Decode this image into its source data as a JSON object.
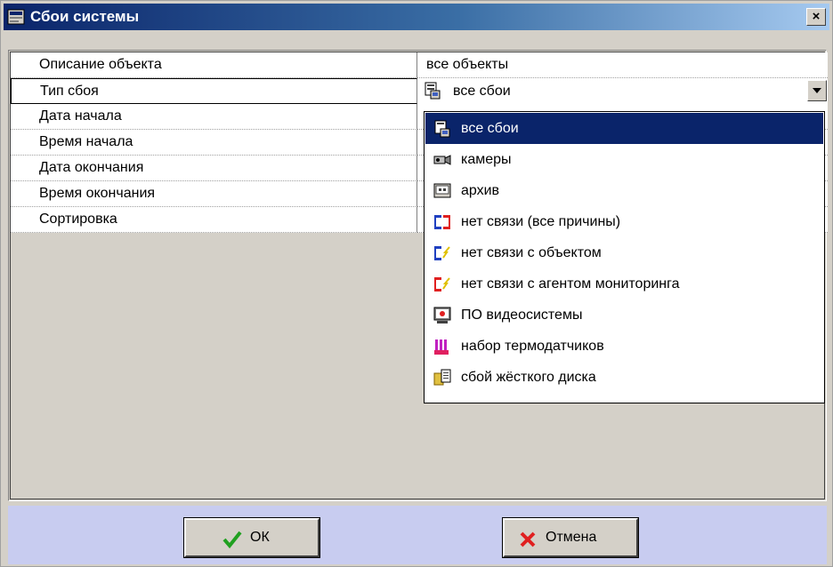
{
  "window": {
    "title": "Сбои системы",
    "close_label": "×"
  },
  "properties": [
    {
      "label": "Описание объекта",
      "value": "все объекты"
    },
    {
      "label": "Тип сбоя",
      "value": "все сбои"
    },
    {
      "label": "Дата начала",
      "value": ""
    },
    {
      "label": "Время начала",
      "value": ""
    },
    {
      "label": "Дата окончания",
      "value": ""
    },
    {
      "label": "Время окончания",
      "value": ""
    },
    {
      "label": "Сортировка",
      "value": ""
    }
  ],
  "dropdown": {
    "selected": "все сбои",
    "items": [
      {
        "label": "все сбои",
        "icon": "all-failures-icon"
      },
      {
        "label": "камеры",
        "icon": "camera-icon"
      },
      {
        "label": "архив",
        "icon": "archive-icon"
      },
      {
        "label": "нет связи (все причины)",
        "icon": "no-connection-icon"
      },
      {
        "label": "нет связи с объектом",
        "icon": "no-connection-object-icon"
      },
      {
        "label": "нет связи с агентом мониторинга",
        "icon": "no-connection-agent-icon"
      },
      {
        "label": "ПО видеосистемы",
        "icon": "video-software-icon"
      },
      {
        "label": "набор термодатчиков",
        "icon": "thermo-sensors-icon"
      },
      {
        "label": "сбой жёсткого диска",
        "icon": "disk-failure-icon"
      }
    ]
  },
  "buttons": {
    "ok_label": "ОК",
    "cancel_label": "Отмена"
  },
  "colors": {
    "title_start": "#0a246a",
    "selection": "#0a246a",
    "bottom_bar": "#c8ccf0"
  }
}
